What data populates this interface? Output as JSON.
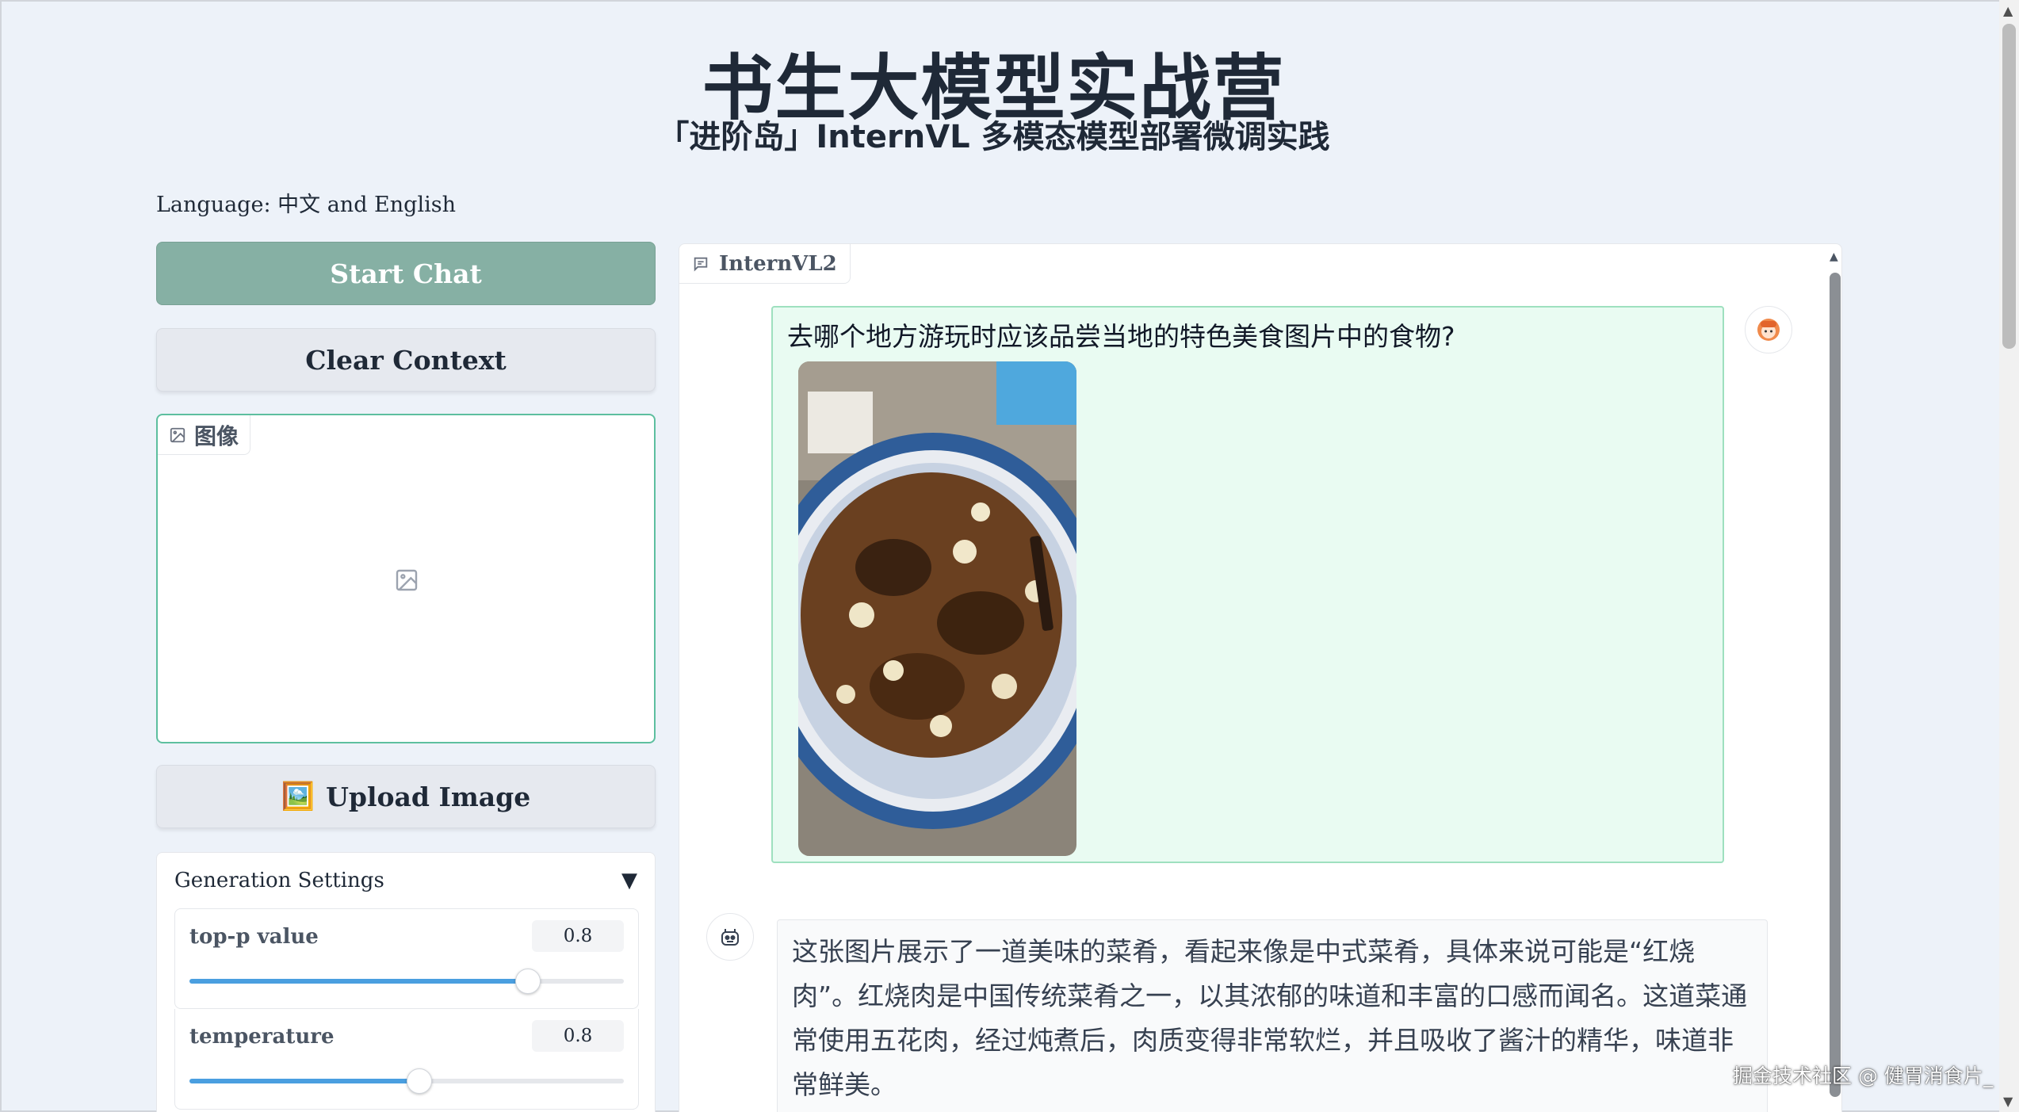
{
  "header": {
    "title": "书生大模型实战营",
    "subtitle": "「进阶岛」InternVL 多模态模型部署微调实践"
  },
  "language_note": "Language: 中文 and English",
  "sidebar": {
    "start_chat_label": "Start Chat",
    "clear_context_label": "Clear Context",
    "image_panel_label": "图像",
    "upload_button": {
      "emoji": "🖼️",
      "label": "Upload Image"
    },
    "generation_settings": {
      "title": "Generation Settings",
      "toggle": "▼",
      "sliders": [
        {
          "label": "top-p value",
          "value": "0.8",
          "fraction": 0.78
        },
        {
          "label": "temperature",
          "value": "0.8",
          "fraction": 0.53
        }
      ]
    }
  },
  "chat": {
    "tab_label": "InternVL2",
    "messages": [
      {
        "role": "user",
        "text": "去哪个地方游玩时应该品尝当地的特色美食图片中的食物?",
        "has_image": true
      },
      {
        "role": "assistant",
        "text": "这张图片展示了一道美味的菜肴，看起来像是中式菜肴，具体来说可能是“红烧肉”。红烧肉是中国传统菜肴之一，以其浓郁的味道和丰富的口感而闻名。这道菜通常使用五花肉，经过炖煮后，肉质变得非常软烂，并且吸收了酱汁的精华，味道非常鲜美。"
      }
    ]
  },
  "watermark": "掘金技术社区 @ 健胃消食片_",
  "colors": {
    "page_bg": "#edf2f9",
    "start_button": "#86b0a4",
    "image_panel_border": "#5dbf9f",
    "user_bubble_bg": "#e9fbf2",
    "user_bubble_border": "#9ee0bf",
    "slider_fill": "#4a9fe0"
  }
}
